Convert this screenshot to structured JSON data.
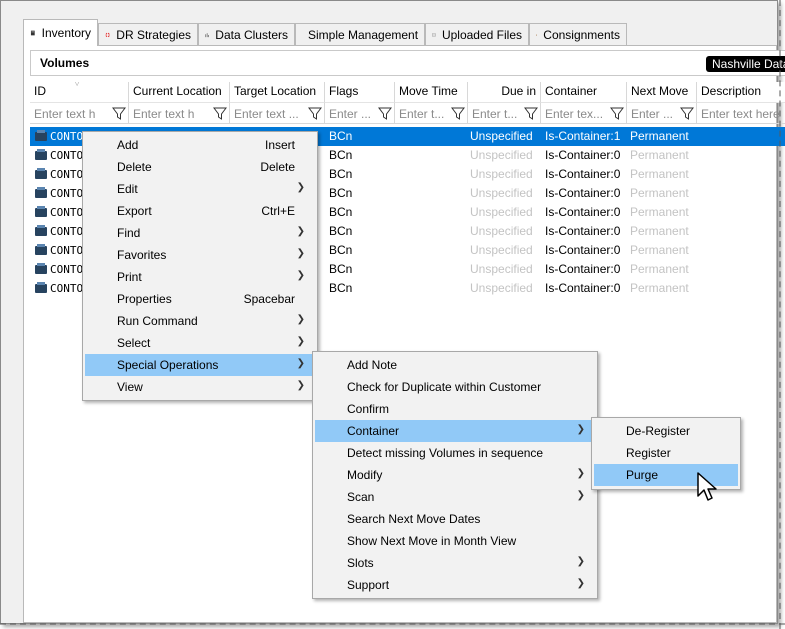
{
  "tabs": [
    {
      "label": "Inventory",
      "icon": "inventory-icon"
    },
    {
      "label": "DR Strategies",
      "icon": "lifebuoy-icon"
    },
    {
      "label": "Data Clusters",
      "icon": "cluster-icon"
    },
    {
      "label": "Simple Management",
      "icon": "management-icon"
    },
    {
      "label": "Uploaded Files",
      "icon": "files-icon"
    },
    {
      "label": "Consignments",
      "icon": "box-icon"
    }
  ],
  "panel": {
    "title": "Volumes",
    "badge": "Nashville Data C"
  },
  "grid": {
    "columns": [
      {
        "label": "ID",
        "placeholder": "Enter text h"
      },
      {
        "label": "Current Location",
        "placeholder": "Enter text h"
      },
      {
        "label": "Target Location",
        "placeholder": "Enter text ..."
      },
      {
        "label": "Flags",
        "placeholder": "Enter ..."
      },
      {
        "label": "Move Time",
        "placeholder": "Enter t..."
      },
      {
        "label": "Due in",
        "placeholder": "Enter t..."
      },
      {
        "label": "Container",
        "placeholder": "Enter tex..."
      },
      {
        "label": "Next Move",
        "placeholder": "Enter ..."
      },
      {
        "label": "Description",
        "placeholder": "Enter text here"
      }
    ],
    "rows": [
      {
        "id": "CONTOSO",
        "flags": "BCn",
        "due": "Unspecified",
        "container": "Is-Container:1",
        "next": "Permanent",
        "selected": true
      },
      {
        "id": "CONTO",
        "flags": "BCn",
        "due": "Unspecified",
        "container": "Is-Container:0",
        "next": "Permanent"
      },
      {
        "id": "CONTO",
        "flags": "BCn",
        "due": "Unspecified",
        "container": "Is-Container:0",
        "next": "Permanent"
      },
      {
        "id": "CONTO",
        "flags": "BCn",
        "due": "Unspecified",
        "container": "Is-Container:0",
        "next": "Permanent"
      },
      {
        "id": "CONTO",
        "flags": "BCn",
        "due": "Unspecified",
        "container": "Is-Container:0",
        "next": "Permanent"
      },
      {
        "id": "CONTO",
        "flags": "BCn",
        "due": "Unspecified",
        "container": "Is-Container:0",
        "next": "Permanent"
      },
      {
        "id": "CONTO",
        "flags": "BCn",
        "due": "Unspecified",
        "container": "Is-Container:0",
        "next": "Permanent"
      },
      {
        "id": "CONTO",
        "flags": "BCn",
        "due": "Unspecified",
        "container": "Is-Container:0",
        "next": "Permanent"
      },
      {
        "id": "CONTO",
        "flags": "BCn",
        "due": "Unspecified",
        "container": "Is-Container:0",
        "next": "Permanent"
      }
    ]
  },
  "context_menu": {
    "items": [
      {
        "label": "Add",
        "shortcut": "Insert"
      },
      {
        "label": "Delete",
        "shortcut": "Delete"
      },
      {
        "label": "Edit",
        "submenu": true
      },
      {
        "label": "Export",
        "shortcut": "Ctrl+E"
      },
      {
        "label": "Find",
        "submenu": true
      },
      {
        "label": "Favorites",
        "submenu": true
      },
      {
        "label": "Print",
        "submenu": true
      },
      {
        "label": "Properties",
        "shortcut": "Spacebar"
      },
      {
        "label": "Run Command",
        "submenu": true
      },
      {
        "label": "Select",
        "submenu": true
      },
      {
        "label": "Special Operations",
        "submenu": true,
        "highlighted": true
      },
      {
        "label": "View",
        "submenu": true
      }
    ]
  },
  "special_ops_menu": {
    "items": [
      {
        "label": "Add Note"
      },
      {
        "label": "Check for Duplicate within Customer"
      },
      {
        "label": "Confirm"
      },
      {
        "label": "Container",
        "submenu": true,
        "highlighted": true
      },
      {
        "label": "Detect missing Volumes in sequence"
      },
      {
        "label": "Modify",
        "submenu": true
      },
      {
        "label": "Scan",
        "submenu": true
      },
      {
        "label": "Search Next Move Dates"
      },
      {
        "label": "Show Next Move in Month View"
      },
      {
        "label": "Slots",
        "submenu": true
      },
      {
        "label": "Support",
        "submenu": true
      }
    ]
  },
  "container_menu": {
    "items": [
      {
        "label": "De-Register"
      },
      {
        "label": "Register"
      },
      {
        "label": "Purge",
        "highlighted": true
      }
    ]
  },
  "colors": {
    "selection": "#0078d7",
    "menu_highlight": "#91c9f7",
    "disabled_text": "#c3c3c3"
  }
}
